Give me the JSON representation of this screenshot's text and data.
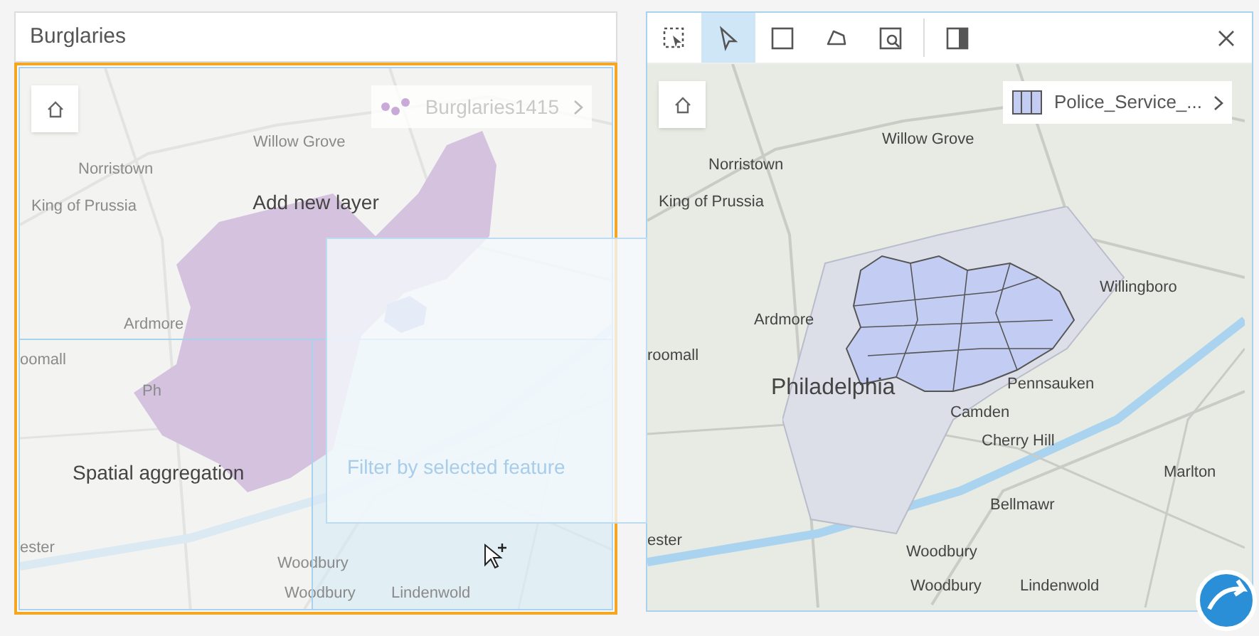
{
  "left_card": {
    "title": "Burglaries",
    "legend": {
      "label": "Burglaries1415"
    },
    "map_labels": [
      "Willow Grove",
      "Norristown",
      "King of Prussia",
      "Ardmore",
      "oomall",
      "Ph",
      "ester",
      "Woodbury",
      "Woodbury",
      "Lindenwold"
    ],
    "drop_zones": [
      {
        "kind": "top",
        "label": "Add new layer"
      },
      {
        "kind": "bottom",
        "label": "Spatial aggregation"
      },
      {
        "kind": "card",
        "label": "Filter by selected feature"
      }
    ]
  },
  "right_card": {
    "tools": [
      {
        "kind": "box-select",
        "selected": false
      },
      {
        "kind": "pointer",
        "selected": true
      },
      {
        "kind": "rectangle",
        "selected": false
      },
      {
        "kind": "lasso",
        "selected": false
      },
      {
        "kind": "zoom-select",
        "selected": false
      },
      {
        "kind": "panel",
        "selected": false
      }
    ],
    "legend": {
      "label": "Police_Service_..."
    },
    "map_labels": [
      {
        "text": "Willow Grove",
        "kind": "place"
      },
      {
        "text": "Norristown",
        "kind": "place"
      },
      {
        "text": "King of Prussia",
        "kind": "place"
      },
      {
        "text": "Ardmore",
        "kind": "place"
      },
      {
        "text": "roomall",
        "kind": "place"
      },
      {
        "text": "Philadelphia",
        "kind": "city"
      },
      {
        "text": "Willingboro",
        "kind": "place"
      },
      {
        "text": "Pennsauken",
        "kind": "place"
      },
      {
        "text": "Camden",
        "kind": "place"
      },
      {
        "text": "Cherry Hill",
        "kind": "place"
      },
      {
        "text": "Marlton",
        "kind": "place"
      },
      {
        "text": "Bellmawr",
        "kind": "place"
      },
      {
        "text": "ester",
        "kind": "place"
      },
      {
        "text": "Woodbury",
        "kind": "place"
      },
      {
        "text": "Woodbury",
        "kind": "place"
      },
      {
        "text": "Lindenwold",
        "kind": "place"
      }
    ]
  }
}
